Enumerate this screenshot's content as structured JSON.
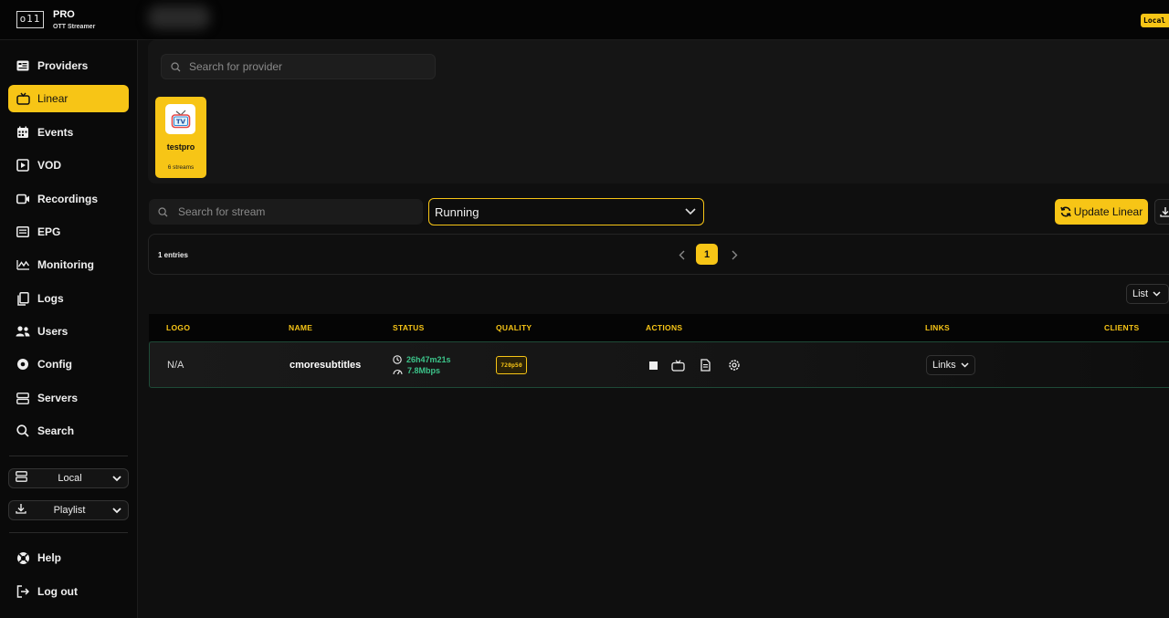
{
  "header": {
    "logo_text": "o11",
    "brand_title": "PRO",
    "brand_subtitle": "OTT Streamer",
    "server_badge": "Local"
  },
  "sidebar": {
    "items": [
      {
        "label": "Providers",
        "icon": "providers-icon",
        "active": false
      },
      {
        "label": "Linear",
        "icon": "tv-icon",
        "active": true
      },
      {
        "label": "Events",
        "icon": "calendar-icon",
        "active": false
      },
      {
        "label": "VOD",
        "icon": "vod-icon",
        "active": false
      },
      {
        "label": "Recordings",
        "icon": "recordings-icon",
        "active": false
      },
      {
        "label": "EPG",
        "icon": "epg-icon",
        "active": false
      },
      {
        "label": "Monitoring",
        "icon": "monitoring-icon",
        "active": false
      },
      {
        "label": "Logs",
        "icon": "logs-icon",
        "active": false
      },
      {
        "label": "Users",
        "icon": "users-icon",
        "active": false
      },
      {
        "label": "Config",
        "icon": "config-icon",
        "active": false
      },
      {
        "label": "Servers",
        "icon": "servers-icon",
        "active": false
      },
      {
        "label": "Search",
        "icon": "search-icon",
        "active": false
      }
    ],
    "server_select": "Local",
    "playlist_select": "Playlist",
    "help_label": "Help",
    "logout_label": "Log out"
  },
  "providers": {
    "search_placeholder": "Search for provider",
    "cards": [
      {
        "name": "testpro",
        "count": "6 streams",
        "logo_text": "TV"
      }
    ]
  },
  "toolbar": {
    "stream_search_placeholder": "Search for stream",
    "status_filter": "Running",
    "update_label": "Update Linear"
  },
  "pagination": {
    "entries": "1 entries",
    "current_page": "1"
  },
  "view_select": "List",
  "table": {
    "columns": [
      "LOGO",
      "NAME",
      "STATUS",
      "QUALITY",
      "ACTIONS",
      "LINKS",
      "CLIENTS"
    ],
    "rows": [
      {
        "logo": "N/A",
        "name": "cmoresubtitles",
        "uptime": "26h47m21s",
        "bitrate": "7.8Mbps",
        "quality": "720p50",
        "links": "Links",
        "clients": ""
      }
    ]
  },
  "colors": {
    "accent": "#f7c516",
    "status_ok": "#3cc48a",
    "background": "#0f0f0f"
  }
}
